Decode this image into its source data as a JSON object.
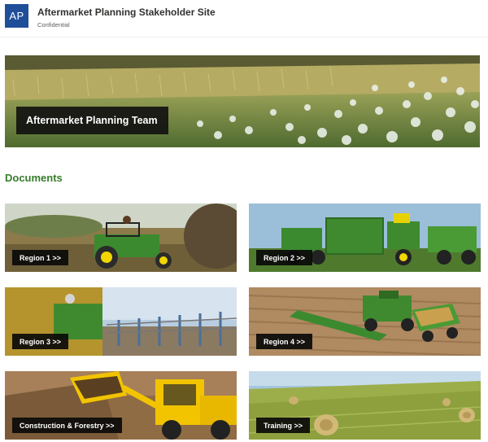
{
  "site": {
    "logo_text": "AP",
    "title": "Aftermarket Planning Stakeholder Site",
    "classification": "Confidential"
  },
  "hero": {
    "label": "Aftermarket Planning Team"
  },
  "documents": {
    "heading": "Documents",
    "tiles": [
      {
        "label": "Region 1 >>"
      },
      {
        "label": "Region 2 >>"
      },
      {
        "label": "Region 3 >>"
      },
      {
        "label": "Region 4 >>"
      },
      {
        "label": "Construction & Forestry >>"
      },
      {
        "label": "Training >>"
      }
    ]
  },
  "colors": {
    "brand_blue": "#1f4f99",
    "heading_green": "#367c2b",
    "deere_green": "#367c2b",
    "deere_yellow": "#ffde00"
  }
}
